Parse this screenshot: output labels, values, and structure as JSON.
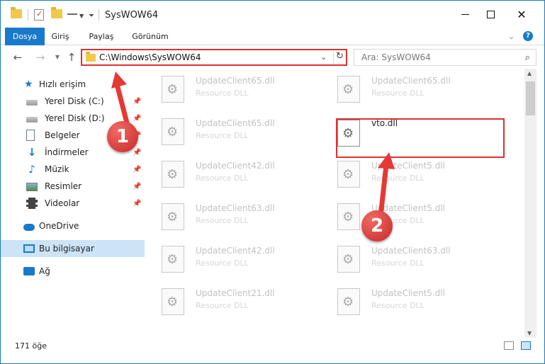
{
  "title": "SysWOW64",
  "ribbon": {
    "tabs": [
      "Dosya",
      "Giriş",
      "Paylaş",
      "Görünüm"
    ]
  },
  "address": {
    "path": "C:\\Windows\\SysWOW64",
    "search_placeholder": "Ara: SysWOW64"
  },
  "sidebar": {
    "quick_access": "Hızlı erişim",
    "items": [
      "Yerel Disk (C:)",
      "Yerel Disk (D:)",
      "Belgeler",
      "İndirmeler",
      "Müzik",
      "Resimler",
      "Videolar"
    ],
    "onedrive": "OneDrive",
    "this_pc": "Bu bilgisayar",
    "network": "Ağ"
  },
  "files": [
    {
      "name": "UpdateClient65.dll",
      "desc": "Resource DLL"
    },
    {
      "name": "UpdateClient65.dll",
      "desc": "Resource DLL"
    },
    {
      "name": "UpdateClient65.dll",
      "desc": "Resource DLL"
    },
    {
      "name": "vto.dll",
      "desc": ""
    },
    {
      "name": "UpdateClient42.dll",
      "desc": "Resource DLL"
    },
    {
      "name": "UpdateClient5.dll",
      "desc": "Resource DLL"
    },
    {
      "name": "UpdateClient63.dll",
      "desc": "Resource DLL"
    },
    {
      "name": "UpdateClient5.dll",
      "desc": "Resource DLL"
    },
    {
      "name": "UpdateClient42.dll",
      "desc": "Resource DLL"
    },
    {
      "name": "UpdateClient63.dll",
      "desc": "Resource DLL"
    },
    {
      "name": "UpdateClient21.dll",
      "desc": "Resource DLL"
    },
    {
      "name": "UpdateClient5.dll",
      "desc": "Resource DLL"
    }
  ],
  "status": {
    "count": "171 öğe"
  },
  "annotations": {
    "step1": "1",
    "step2": "2"
  },
  "colors": {
    "accent": "#1979ca",
    "highlight": "#e03030",
    "selected": "#cce4f7"
  }
}
